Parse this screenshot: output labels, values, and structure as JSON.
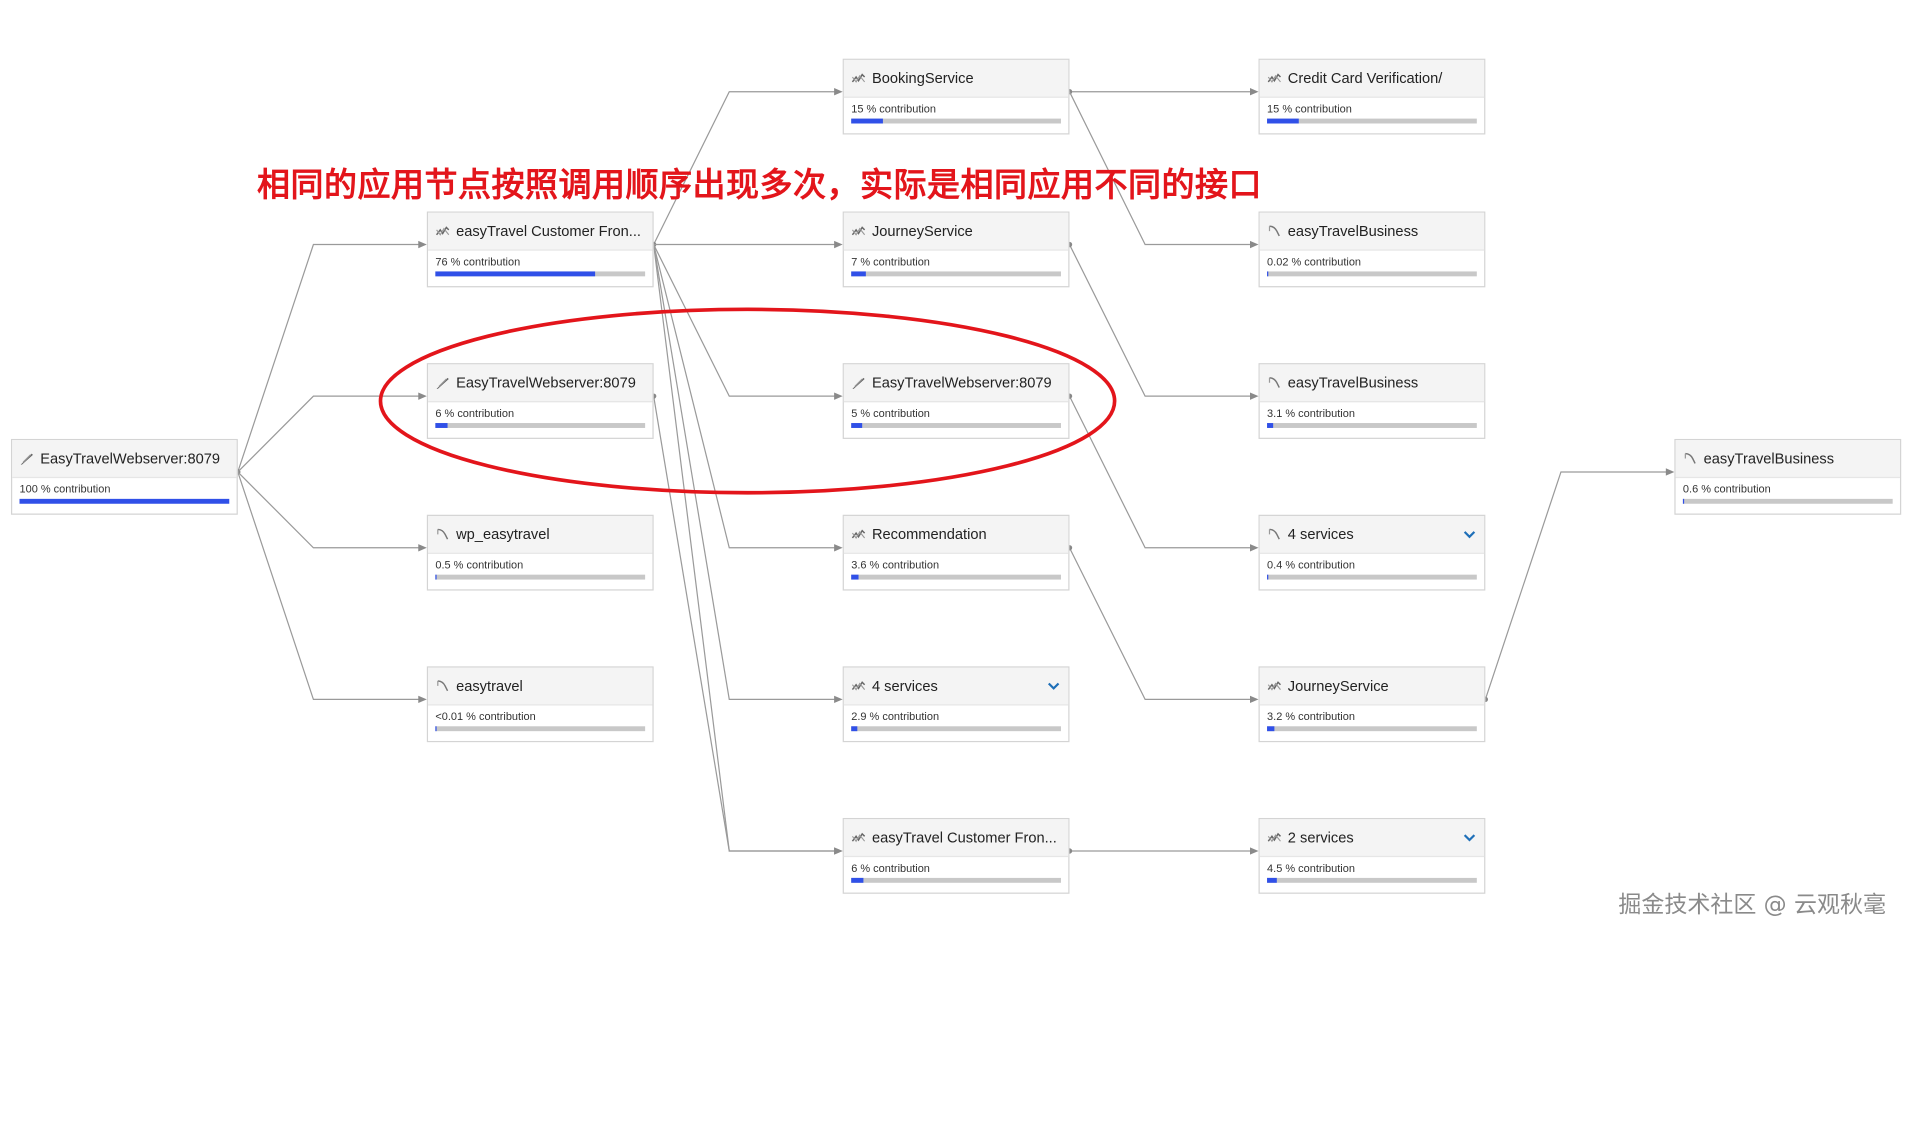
{
  "annotation_text": "相同的应用节点按照调用顺序出现多次，实际是相同应用不同的接口",
  "watermark_text": "掘金技术社区 @ 云观秋毫",
  "colors": {
    "accent": "#3050e8",
    "bar_bg": "#c8c8c8",
    "annotation": "#e3151b",
    "edge": "#9a9a9a"
  },
  "nodes": [
    {
      "id": "n0",
      "title": "EasyTravelWebserver:8079",
      "contribution": "100 % contribution",
      "fill_pct": 100,
      "icon": "webserver-icon",
      "expandable": false
    },
    {
      "id": "n1",
      "title": "easyTravel Customer Fron...",
      "contribution": "76 % contribution",
      "fill_pct": 76,
      "icon": "service-icon",
      "expandable": false
    },
    {
      "id": "n2",
      "title": "EasyTravelWebserver:8079",
      "contribution": "6 % contribution",
      "fill_pct": 6,
      "icon": "webserver-icon",
      "expandable": false
    },
    {
      "id": "n3",
      "title": "wp_easytravel",
      "contribution": "0.5 % contribution",
      "fill_pct": 0.5,
      "icon": "database-icon",
      "expandable": false
    },
    {
      "id": "n4",
      "title": "easytravel",
      "contribution": "<0.01 % contribution",
      "fill_pct": 0.01,
      "icon": "database-icon",
      "expandable": false
    },
    {
      "id": "n5",
      "title": "BookingService",
      "contribution": "15 % contribution",
      "fill_pct": 15,
      "icon": "service-icon",
      "expandable": false
    },
    {
      "id": "n6",
      "title": "JourneyService",
      "contribution": "7 % contribution",
      "fill_pct": 7,
      "icon": "service-icon",
      "expandable": false
    },
    {
      "id": "n7",
      "title": "EasyTravelWebserver:8079",
      "contribution": "5 % contribution",
      "fill_pct": 5,
      "icon": "webserver-icon",
      "expandable": false
    },
    {
      "id": "n8",
      "title": "Recommendation",
      "contribution": "3.6 % contribution",
      "fill_pct": 3.6,
      "icon": "service-icon",
      "expandable": false
    },
    {
      "id": "n9",
      "title": "4 services",
      "contribution": "2.9 % contribution",
      "fill_pct": 2.9,
      "icon": "service-icon",
      "expandable": true
    },
    {
      "id": "n10",
      "title": "easyTravel Customer Fron...",
      "contribution": "6 % contribution",
      "fill_pct": 6,
      "icon": "service-icon",
      "expandable": false
    },
    {
      "id": "n11",
      "title": "Credit Card Verification/",
      "contribution": "15 % contribution",
      "fill_pct": 15,
      "icon": "service-icon",
      "expandable": false
    },
    {
      "id": "n12",
      "title": "easyTravelBusiness",
      "contribution": "0.02 % contribution",
      "fill_pct": 0.02,
      "icon": "database-icon",
      "expandable": false
    },
    {
      "id": "n13",
      "title": "easyTravelBusiness",
      "contribution": "3.1 % contribution",
      "fill_pct": 3.1,
      "icon": "database-icon",
      "expandable": false
    },
    {
      "id": "n14",
      "title": "4 services",
      "contribution": "0.4 % contribution",
      "fill_pct": 0.4,
      "icon": "database-icon",
      "expandable": true
    },
    {
      "id": "n15",
      "title": "JourneyService",
      "contribution": "3.2 % contribution",
      "fill_pct": 3.2,
      "icon": "service-icon",
      "expandable": false
    },
    {
      "id": "n16",
      "title": "2 services",
      "contribution": "4.5 % contribution",
      "fill_pct": 4.5,
      "icon": "service-icon",
      "expandable": true
    },
    {
      "id": "n17",
      "title": "easyTravelBusiness",
      "contribution": "0.6 % contribution",
      "fill_pct": 0.6,
      "icon": "database-icon",
      "expandable": false
    }
  ],
  "edges": [
    [
      "n0",
      "n1"
    ],
    [
      "n0",
      "n2"
    ],
    [
      "n0",
      "n3"
    ],
    [
      "n0",
      "n4"
    ],
    [
      "n1",
      "n5"
    ],
    [
      "n1",
      "n6"
    ],
    [
      "n1",
      "n7"
    ],
    [
      "n1",
      "n8"
    ],
    [
      "n1",
      "n9"
    ],
    [
      "n1",
      "n10"
    ],
    [
      "n2",
      "n10"
    ],
    [
      "n5",
      "n11"
    ],
    [
      "n5",
      "n12"
    ],
    [
      "n6",
      "n13"
    ],
    [
      "n7",
      "n14"
    ],
    [
      "n8",
      "n15"
    ],
    [
      "n10",
      "n16"
    ],
    [
      "n15",
      "n17"
    ]
  ]
}
